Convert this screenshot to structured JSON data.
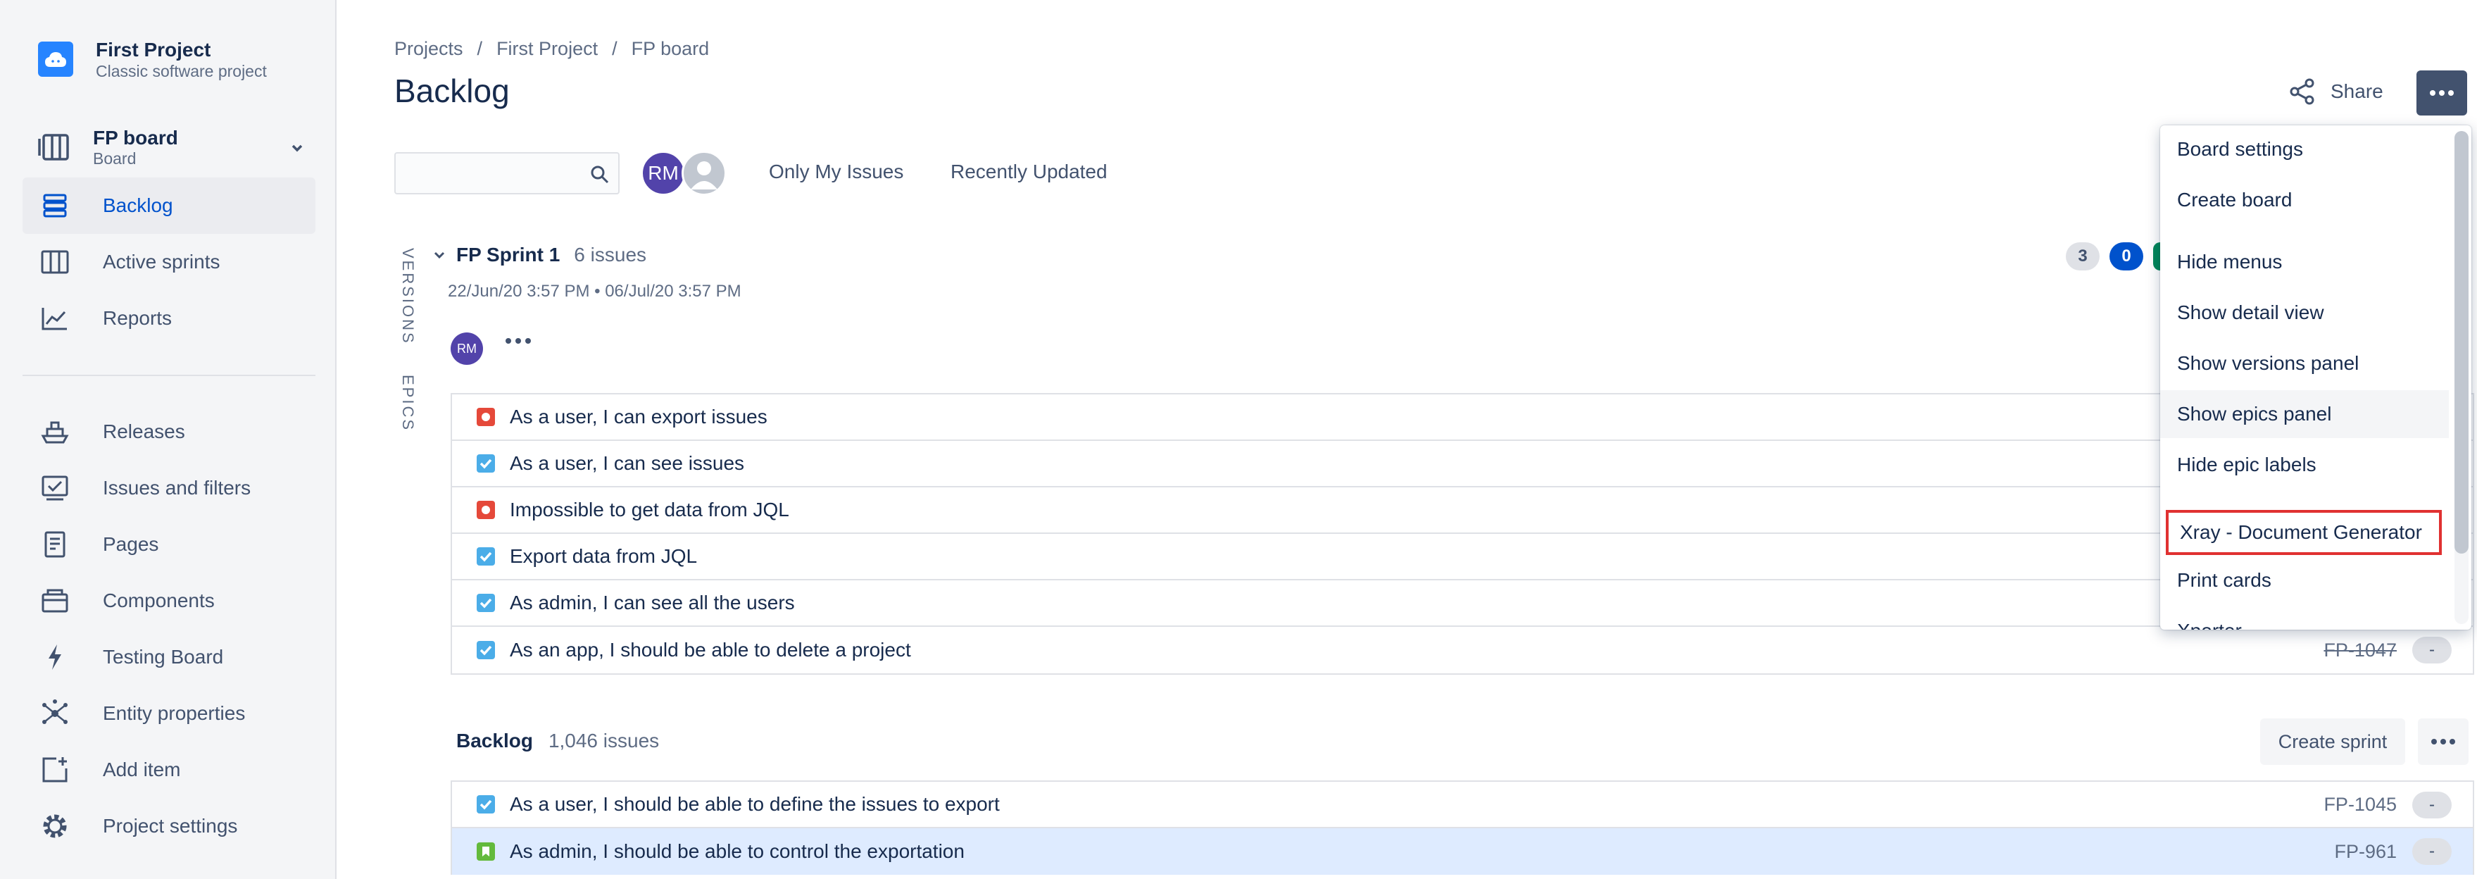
{
  "project": {
    "name": "First Project",
    "type": "Classic software project"
  },
  "board": {
    "name": "FP board",
    "type": "Board"
  },
  "nav": {
    "backlog": "Backlog",
    "active_sprints": "Active sprints",
    "reports": "Reports",
    "releases": "Releases",
    "issues_filters": "Issues and filters",
    "pages": "Pages",
    "components": "Components",
    "testing_board": "Testing Board",
    "entity_properties": "Entity properties",
    "add_item": "Add item",
    "project_settings": "Project settings"
  },
  "breadcrumb": {
    "projects": "Projects",
    "project": "First Project",
    "board": "FP board",
    "sep": "/"
  },
  "page_title": "Backlog",
  "share_label": "Share",
  "search": {
    "value": "",
    "placeholder": ""
  },
  "avatar_initials": "RM",
  "quick_filters": {
    "only_mine": "Only My Issues",
    "recent": "Recently Updated"
  },
  "side_tabs": {
    "versions": "VERSIONS",
    "epics": "EPICS"
  },
  "sprint": {
    "name": "FP Sprint 1",
    "count": "6 issues",
    "dates": "22/Jun/20 3:57 PM  •  06/Jul/20 3:57 PM",
    "badges": {
      "todo": "3",
      "in_progress": "0"
    },
    "issues": [
      {
        "type": "bug",
        "summary": "As a user, I can export issues"
      },
      {
        "type": "task",
        "summary": "As a user, I can see issues"
      },
      {
        "type": "bug",
        "summary": "Impossible to get data from JQL"
      },
      {
        "type": "task",
        "summary": "Export data from JQL"
      },
      {
        "type": "task",
        "summary": "As admin, I can see all the users"
      },
      {
        "type": "task",
        "summary": "As an app, I should be able to delete a project",
        "key": "FP-1047",
        "estimate": "-"
      }
    ]
  },
  "backlog": {
    "name": "Backlog",
    "count": "1,046 issues",
    "create_sprint": "Create sprint",
    "issues": [
      {
        "type": "task",
        "summary": "As a user, I should be able to define the issues to export",
        "key": "FP-1045",
        "estimate": "-"
      },
      {
        "type": "story",
        "summary": "As admin, I should be able to control the exportation",
        "key": "FP-961",
        "estimate": "-"
      }
    ]
  },
  "menu": {
    "board_settings": "Board settings",
    "create_board": "Create board",
    "hide_menus": "Hide menus",
    "show_detail": "Show detail view",
    "show_versions": "Show versions panel",
    "show_epics": "Show epics panel",
    "hide_epic_labels": "Hide epic labels",
    "xray_doc": "Xray - Document Generator",
    "print_cards": "Print cards",
    "xporter": "Xporter"
  },
  "colors": {
    "accent": "#0052cc",
    "bug": "#e5493a",
    "task": "#4bade8",
    "story": "#63ba3c",
    "highlight": "#e03131"
  }
}
